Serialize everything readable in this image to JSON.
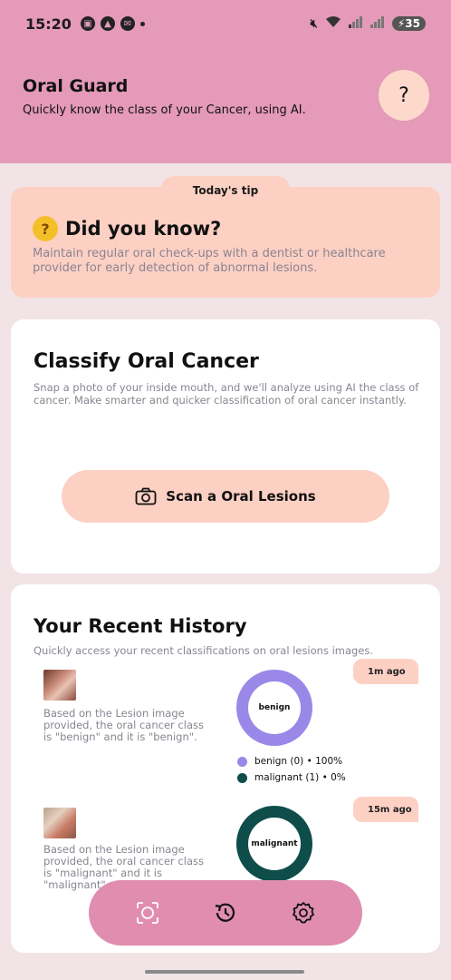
{
  "status_bar": {
    "time": "15:20",
    "battery": "35"
  },
  "header": {
    "title": "Oral Guard",
    "subtitle": "Quickly know the class of your Cancer, using AI.",
    "help_label": "?"
  },
  "tip": {
    "tab_label": "Today's tip",
    "title": "Did you know?",
    "emoji_icon": "thinking-face-icon",
    "text": "Maintain regular oral check-ups with a dentist or healthcare provider for early detection of abnormal lesions."
  },
  "classify": {
    "title": "Classify Oral Cancer",
    "description": "Snap a photo of your inside mouth, and we'll analyze using AI the class of cancer. Make smarter and quicker classification of oral cancer instantly.",
    "scan_button_label": "Scan a Oral Lesions",
    "scan_icon": "camera-icon"
  },
  "history": {
    "title": "Your Recent History",
    "subtitle": "Quickly access your recent classifications on oral lesions images.",
    "items": [
      {
        "text": "Based on the Lesion image provided, the oral cancer class is \"benign\" and it is \"benign\".",
        "time": "1m ago",
        "donut_label": "benign",
        "donut_color": "#9a88e8",
        "legend": [
          {
            "label": "benign (0) • 100%",
            "color": "#9a88e8"
          },
          {
            "label": "malignant (1) • 0%",
            "color": "#0e4d4a"
          }
        ]
      },
      {
        "text": "Based on the Lesion image provided, the oral cancer class is \"malignant\" and it is \"malignant\".",
        "time": "15m ago",
        "donut_label": "malignant",
        "donut_color": "#0e4d4a"
      }
    ]
  },
  "nav": {
    "items": [
      "scan-icon",
      "history-icon",
      "settings-icon"
    ]
  },
  "colors": {
    "header_bg": "#e49ab8",
    "accent_peach": "#fdd0c4",
    "nav_bg": "#e08db0",
    "page_bg": "#f2e4e6"
  }
}
